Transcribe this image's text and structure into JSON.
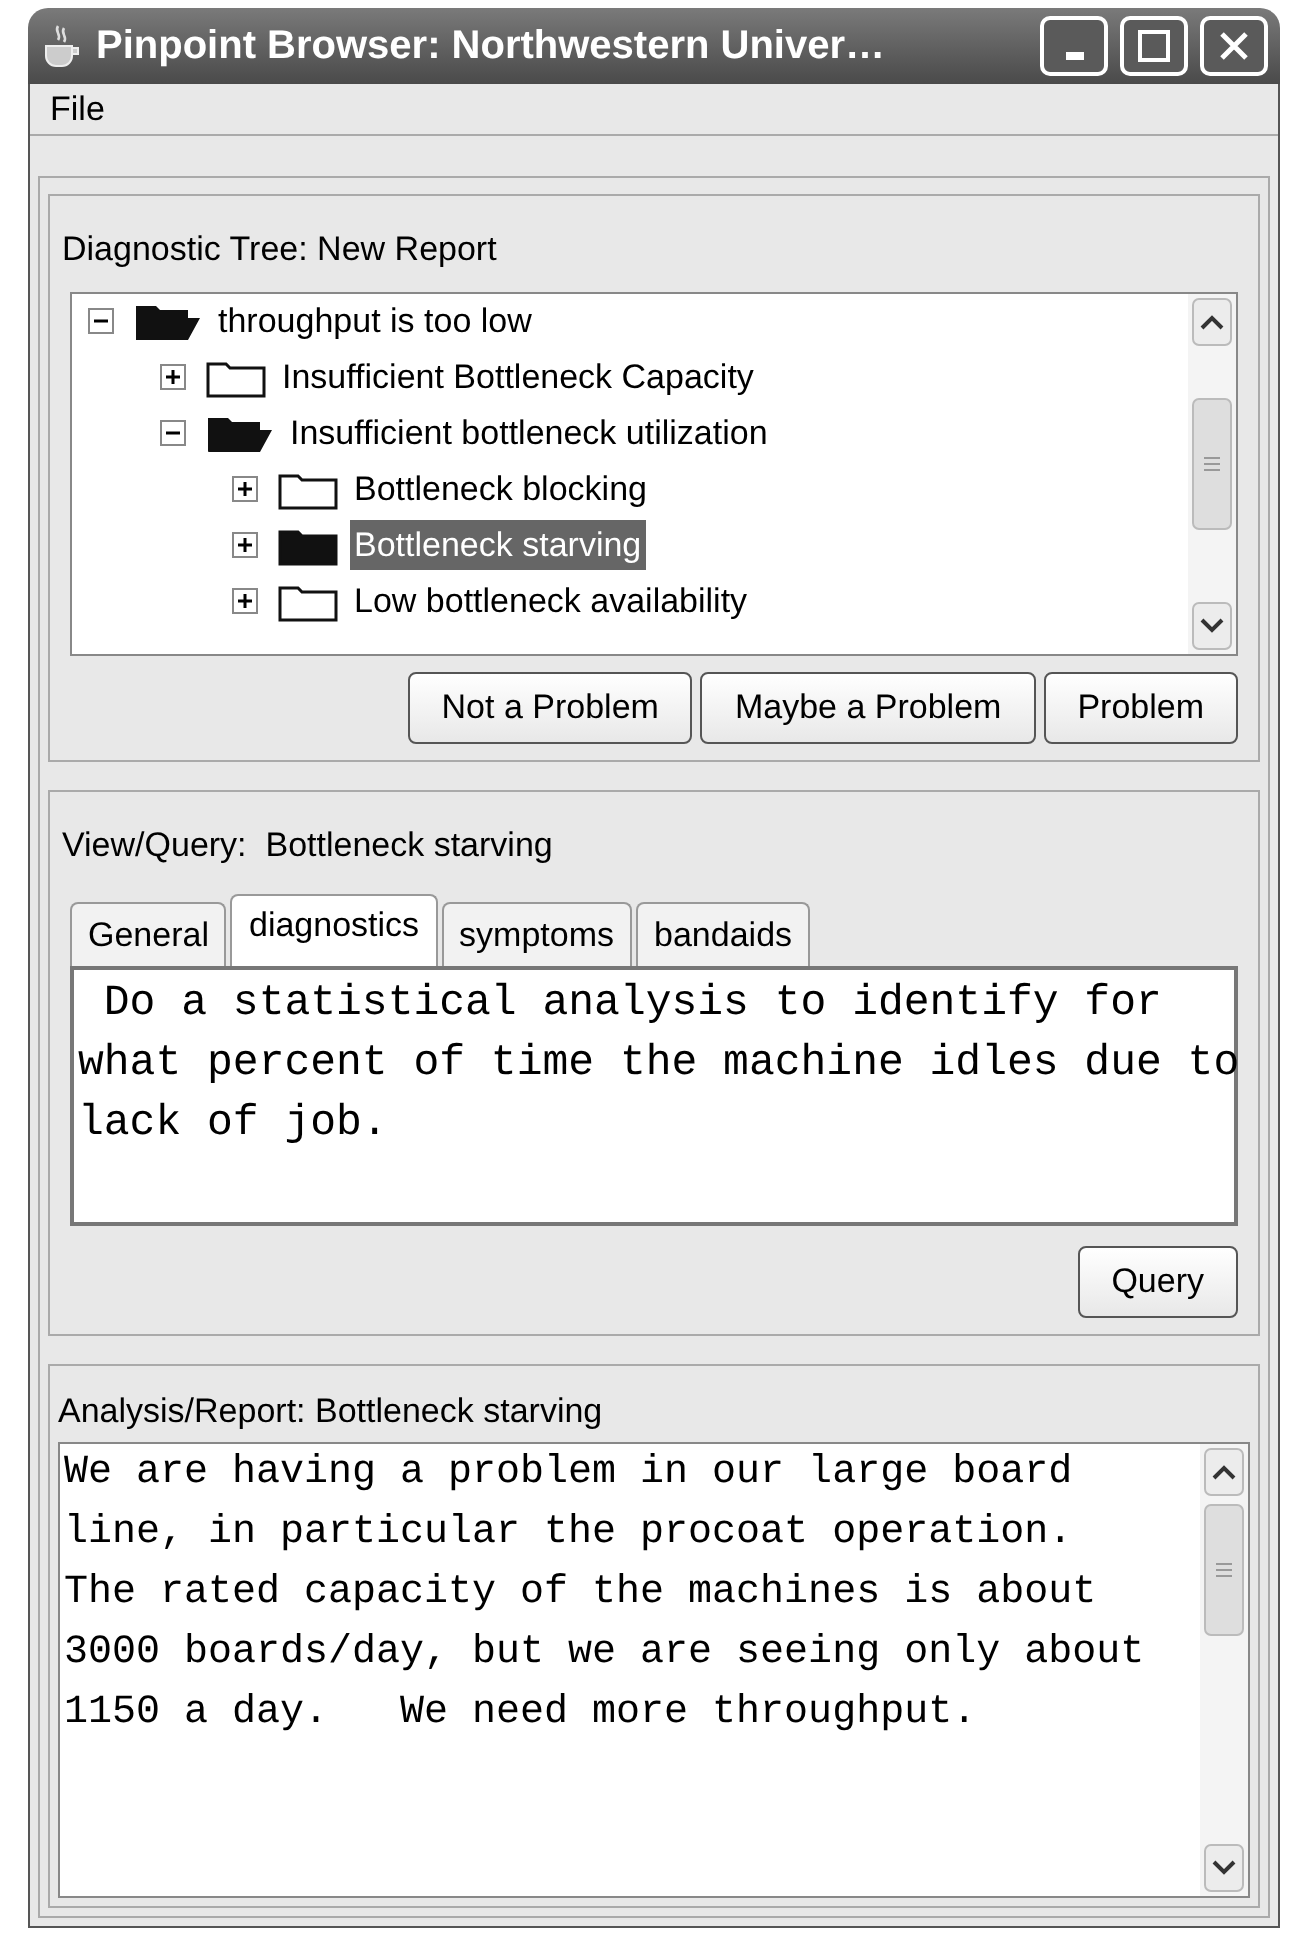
{
  "window": {
    "title": "Pinpoint Browser: Northwestern Univer…"
  },
  "menu": [
    "File"
  ],
  "tree_panel": {
    "title": "Diagnostic Tree: New Report",
    "tree": [
      {
        "label": "throughput is too low",
        "expanded": true,
        "selected": false,
        "children": [
          {
            "label": "Insufficient Bottleneck Capacity",
            "expanded": false,
            "selected": false
          },
          {
            "label": "Insufficient bottleneck utilization",
            "expanded": true,
            "selected": false,
            "children": [
              {
                "label": "Bottleneck blocking",
                "expanded": false,
                "selected": false
              },
              {
                "label": "Bottleneck starving",
                "expanded": false,
                "selected": true
              },
              {
                "label": "Low bottleneck availability",
                "expanded": false,
                "selected": false
              }
            ]
          }
        ]
      }
    ],
    "buttons": [
      "Not a Problem",
      "Maybe a Problem",
      "Problem"
    ]
  },
  "query_panel": {
    "title": "View/Query:  Bottleneck starving",
    "tabs": [
      {
        "label": "General",
        "selected": false
      },
      {
        "label": "diagnostics",
        "selected": true
      },
      {
        "label": "symptoms",
        "selected": false
      },
      {
        "label": "bandaids",
        "selected": false
      }
    ],
    "lines": [
      " Do a statistical analysis to identify for",
      "what percent of time the machine idles due to",
      "lack of job."
    ],
    "button": "Query"
  },
  "report_panel": {
    "title": "Analysis/Report: Bottleneck starving",
    "lines": [
      "We are having a problem in our large board",
      "line, in particular the procoat operation.",
      "The rated capacity of the machines is about",
      "3000 boards/day, but we are seeing only about",
      "1150 a day.   We need more throughput."
    ]
  }
}
